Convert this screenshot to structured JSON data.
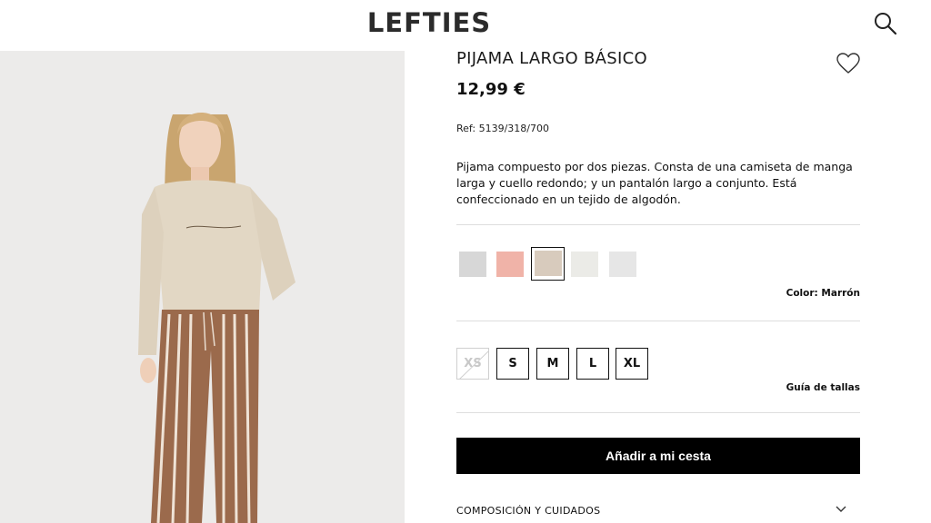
{
  "header": {
    "logo_text": "LEFTIES",
    "search_icon": "search-icon"
  },
  "product": {
    "title": "PIJAMA LARGO BÁSICO",
    "price": "12,99 €",
    "reference": "Ref: 5139/318/700",
    "description": "Pijama compuesto por dos piezas. Consta de una camiseta de manga larga y cuello redondo; y un pantalón largo a conjunto. Está confeccionado en un tejido de algodón.",
    "wishlist_icon": "heart-icon"
  },
  "colors": {
    "swatches": [
      {
        "name": "gris",
        "hex": "#d7d7d7",
        "selected": false
      },
      {
        "name": "rosa",
        "hex": "#f0b3a8",
        "selected": false
      },
      {
        "name": "marron",
        "hex": "#d8cbbd",
        "selected": true
      },
      {
        "name": "crudo",
        "hex": "#ebebe7",
        "selected": false
      },
      {
        "name": "gris-claro",
        "hex": "#e6e6e6",
        "selected": false
      }
    ],
    "selected_label": "Color: Marrón"
  },
  "sizes": {
    "options": [
      {
        "label": "XS",
        "available": false
      },
      {
        "label": "S",
        "available": true
      },
      {
        "label": "M",
        "available": true
      },
      {
        "label": "L",
        "available": true
      },
      {
        "label": "XL",
        "available": true
      }
    ],
    "guide_label": "Guía de tallas"
  },
  "actions": {
    "add_to_cart": "Añadir a mi cesta"
  },
  "sections": {
    "composition": "COMPOSICIÓN Y CUIDADOS"
  },
  "colors_theme": {
    "primary": "#000000",
    "divider": "#dedede",
    "photo_bg": "#ecebea"
  }
}
